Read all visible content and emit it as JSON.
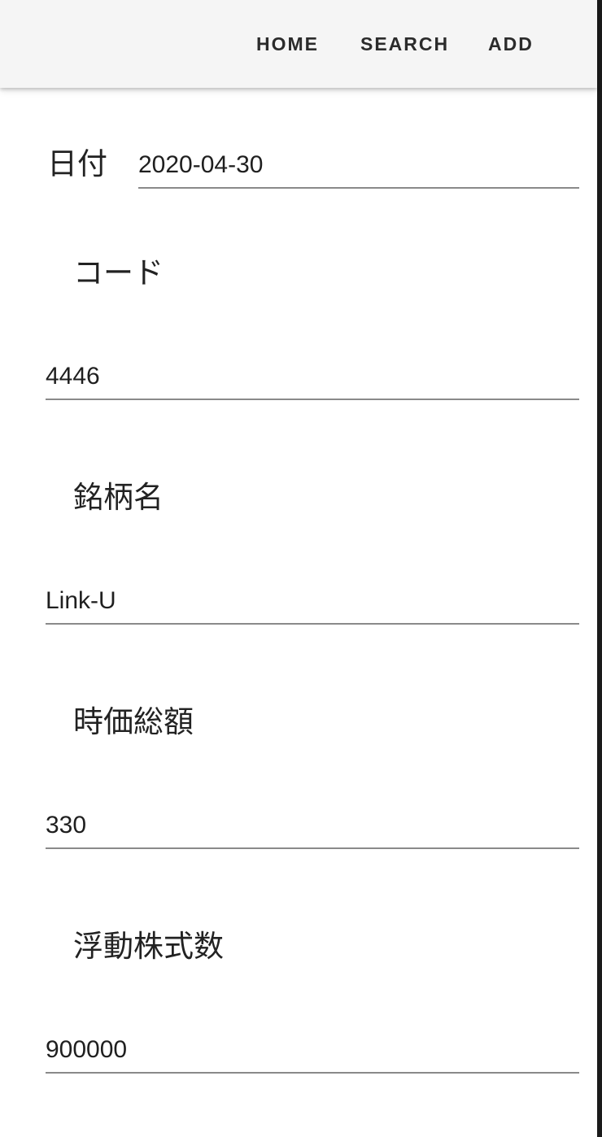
{
  "nav": {
    "home": "HOME",
    "search": "SEARCH",
    "add": "ADD"
  },
  "form": {
    "date_label": "日付",
    "date_value": "2020-04-30",
    "code_label": "コード",
    "code_value": "4446",
    "name_label": "銘柄名",
    "name_value": "Link-U",
    "market_cap_label": "時価総額",
    "market_cap_value": "330",
    "float_label": "浮動株式数",
    "float_value": "900000"
  },
  "colors": {
    "app_bar": "#f5f5f5",
    "underline": "#8a8a8a",
    "text": "#212121"
  }
}
